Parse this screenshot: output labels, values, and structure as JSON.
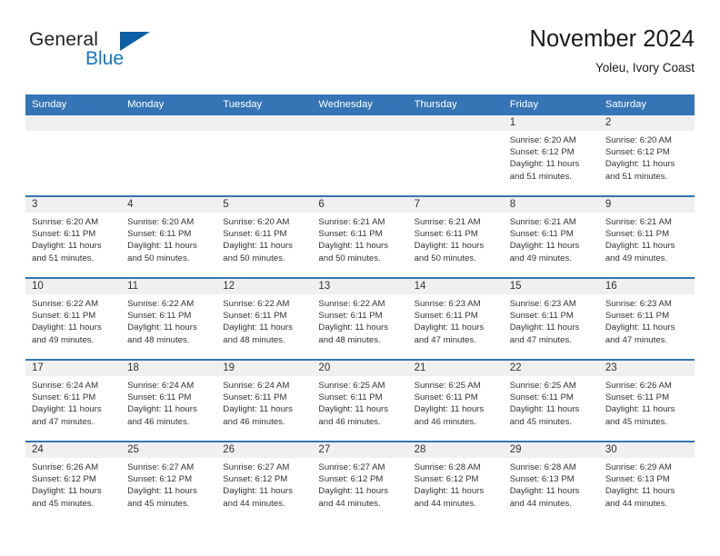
{
  "brand": {
    "word1": "General",
    "word2": "Blue",
    "triangle_color": "#0b5fa5",
    "blue_text_color": "#1476c4"
  },
  "header": {
    "title": "November 2024",
    "location": "Yoleu, Ivory Coast",
    "accent_color": "#3575b5",
    "band_color": "#f0f0f0"
  },
  "weekdays": [
    "Sunday",
    "Monday",
    "Tuesday",
    "Wednesday",
    "Thursday",
    "Friday",
    "Saturday"
  ],
  "weeks": [
    [
      {
        "day": "",
        "sunrise": "",
        "sunset": "",
        "daylight_line1": "",
        "daylight_line2": ""
      },
      {
        "day": "",
        "sunrise": "",
        "sunset": "",
        "daylight_line1": "",
        "daylight_line2": ""
      },
      {
        "day": "",
        "sunrise": "",
        "sunset": "",
        "daylight_line1": "",
        "daylight_line2": ""
      },
      {
        "day": "",
        "sunrise": "",
        "sunset": "",
        "daylight_line1": "",
        "daylight_line2": ""
      },
      {
        "day": "",
        "sunrise": "",
        "sunset": "",
        "daylight_line1": "",
        "daylight_line2": ""
      },
      {
        "day": "1",
        "sunrise": "Sunrise: 6:20 AM",
        "sunset": "Sunset: 6:12 PM",
        "daylight_line1": "Daylight: 11 hours",
        "daylight_line2": "and 51 minutes."
      },
      {
        "day": "2",
        "sunrise": "Sunrise: 6:20 AM",
        "sunset": "Sunset: 6:12 PM",
        "daylight_line1": "Daylight: 11 hours",
        "daylight_line2": "and 51 minutes."
      }
    ],
    [
      {
        "day": "3",
        "sunrise": "Sunrise: 6:20 AM",
        "sunset": "Sunset: 6:11 PM",
        "daylight_line1": "Daylight: 11 hours",
        "daylight_line2": "and 51 minutes."
      },
      {
        "day": "4",
        "sunrise": "Sunrise: 6:20 AM",
        "sunset": "Sunset: 6:11 PM",
        "daylight_line1": "Daylight: 11 hours",
        "daylight_line2": "and 50 minutes."
      },
      {
        "day": "5",
        "sunrise": "Sunrise: 6:20 AM",
        "sunset": "Sunset: 6:11 PM",
        "daylight_line1": "Daylight: 11 hours",
        "daylight_line2": "and 50 minutes."
      },
      {
        "day": "6",
        "sunrise": "Sunrise: 6:21 AM",
        "sunset": "Sunset: 6:11 PM",
        "daylight_line1": "Daylight: 11 hours",
        "daylight_line2": "and 50 minutes."
      },
      {
        "day": "7",
        "sunrise": "Sunrise: 6:21 AM",
        "sunset": "Sunset: 6:11 PM",
        "daylight_line1": "Daylight: 11 hours",
        "daylight_line2": "and 50 minutes."
      },
      {
        "day": "8",
        "sunrise": "Sunrise: 6:21 AM",
        "sunset": "Sunset: 6:11 PM",
        "daylight_line1": "Daylight: 11 hours",
        "daylight_line2": "and 49 minutes."
      },
      {
        "day": "9",
        "sunrise": "Sunrise: 6:21 AM",
        "sunset": "Sunset: 6:11 PM",
        "daylight_line1": "Daylight: 11 hours",
        "daylight_line2": "and 49 minutes."
      }
    ],
    [
      {
        "day": "10",
        "sunrise": "Sunrise: 6:22 AM",
        "sunset": "Sunset: 6:11 PM",
        "daylight_line1": "Daylight: 11 hours",
        "daylight_line2": "and 49 minutes."
      },
      {
        "day": "11",
        "sunrise": "Sunrise: 6:22 AM",
        "sunset": "Sunset: 6:11 PM",
        "daylight_line1": "Daylight: 11 hours",
        "daylight_line2": "and 48 minutes."
      },
      {
        "day": "12",
        "sunrise": "Sunrise: 6:22 AM",
        "sunset": "Sunset: 6:11 PM",
        "daylight_line1": "Daylight: 11 hours",
        "daylight_line2": "and 48 minutes."
      },
      {
        "day": "13",
        "sunrise": "Sunrise: 6:22 AM",
        "sunset": "Sunset: 6:11 PM",
        "daylight_line1": "Daylight: 11 hours",
        "daylight_line2": "and 48 minutes."
      },
      {
        "day": "14",
        "sunrise": "Sunrise: 6:23 AM",
        "sunset": "Sunset: 6:11 PM",
        "daylight_line1": "Daylight: 11 hours",
        "daylight_line2": "and 47 minutes."
      },
      {
        "day": "15",
        "sunrise": "Sunrise: 6:23 AM",
        "sunset": "Sunset: 6:11 PM",
        "daylight_line1": "Daylight: 11 hours",
        "daylight_line2": "and 47 minutes."
      },
      {
        "day": "16",
        "sunrise": "Sunrise: 6:23 AM",
        "sunset": "Sunset: 6:11 PM",
        "daylight_line1": "Daylight: 11 hours",
        "daylight_line2": "and 47 minutes."
      }
    ],
    [
      {
        "day": "17",
        "sunrise": "Sunrise: 6:24 AM",
        "sunset": "Sunset: 6:11 PM",
        "daylight_line1": "Daylight: 11 hours",
        "daylight_line2": "and 47 minutes."
      },
      {
        "day": "18",
        "sunrise": "Sunrise: 6:24 AM",
        "sunset": "Sunset: 6:11 PM",
        "daylight_line1": "Daylight: 11 hours",
        "daylight_line2": "and 46 minutes."
      },
      {
        "day": "19",
        "sunrise": "Sunrise: 6:24 AM",
        "sunset": "Sunset: 6:11 PM",
        "daylight_line1": "Daylight: 11 hours",
        "daylight_line2": "and 46 minutes."
      },
      {
        "day": "20",
        "sunrise": "Sunrise: 6:25 AM",
        "sunset": "Sunset: 6:11 PM",
        "daylight_line1": "Daylight: 11 hours",
        "daylight_line2": "and 46 minutes."
      },
      {
        "day": "21",
        "sunrise": "Sunrise: 6:25 AM",
        "sunset": "Sunset: 6:11 PM",
        "daylight_line1": "Daylight: 11 hours",
        "daylight_line2": "and 46 minutes."
      },
      {
        "day": "22",
        "sunrise": "Sunrise: 6:25 AM",
        "sunset": "Sunset: 6:11 PM",
        "daylight_line1": "Daylight: 11 hours",
        "daylight_line2": "and 45 minutes."
      },
      {
        "day": "23",
        "sunrise": "Sunrise: 6:26 AM",
        "sunset": "Sunset: 6:11 PM",
        "daylight_line1": "Daylight: 11 hours",
        "daylight_line2": "and 45 minutes."
      }
    ],
    [
      {
        "day": "24",
        "sunrise": "Sunrise: 6:26 AM",
        "sunset": "Sunset: 6:12 PM",
        "daylight_line1": "Daylight: 11 hours",
        "daylight_line2": "and 45 minutes."
      },
      {
        "day": "25",
        "sunrise": "Sunrise: 6:27 AM",
        "sunset": "Sunset: 6:12 PM",
        "daylight_line1": "Daylight: 11 hours",
        "daylight_line2": "and 45 minutes."
      },
      {
        "day": "26",
        "sunrise": "Sunrise: 6:27 AM",
        "sunset": "Sunset: 6:12 PM",
        "daylight_line1": "Daylight: 11 hours",
        "daylight_line2": "and 44 minutes."
      },
      {
        "day": "27",
        "sunrise": "Sunrise: 6:27 AM",
        "sunset": "Sunset: 6:12 PM",
        "daylight_line1": "Daylight: 11 hours",
        "daylight_line2": "and 44 minutes."
      },
      {
        "day": "28",
        "sunrise": "Sunrise: 6:28 AM",
        "sunset": "Sunset: 6:12 PM",
        "daylight_line1": "Daylight: 11 hours",
        "daylight_line2": "and 44 minutes."
      },
      {
        "day": "29",
        "sunrise": "Sunrise: 6:28 AM",
        "sunset": "Sunset: 6:13 PM",
        "daylight_line1": "Daylight: 11 hours",
        "daylight_line2": "and 44 minutes."
      },
      {
        "day": "30",
        "sunrise": "Sunrise: 6:29 AM",
        "sunset": "Sunset: 6:13 PM",
        "daylight_line1": "Daylight: 11 hours",
        "daylight_line2": "and 44 minutes."
      }
    ]
  ]
}
